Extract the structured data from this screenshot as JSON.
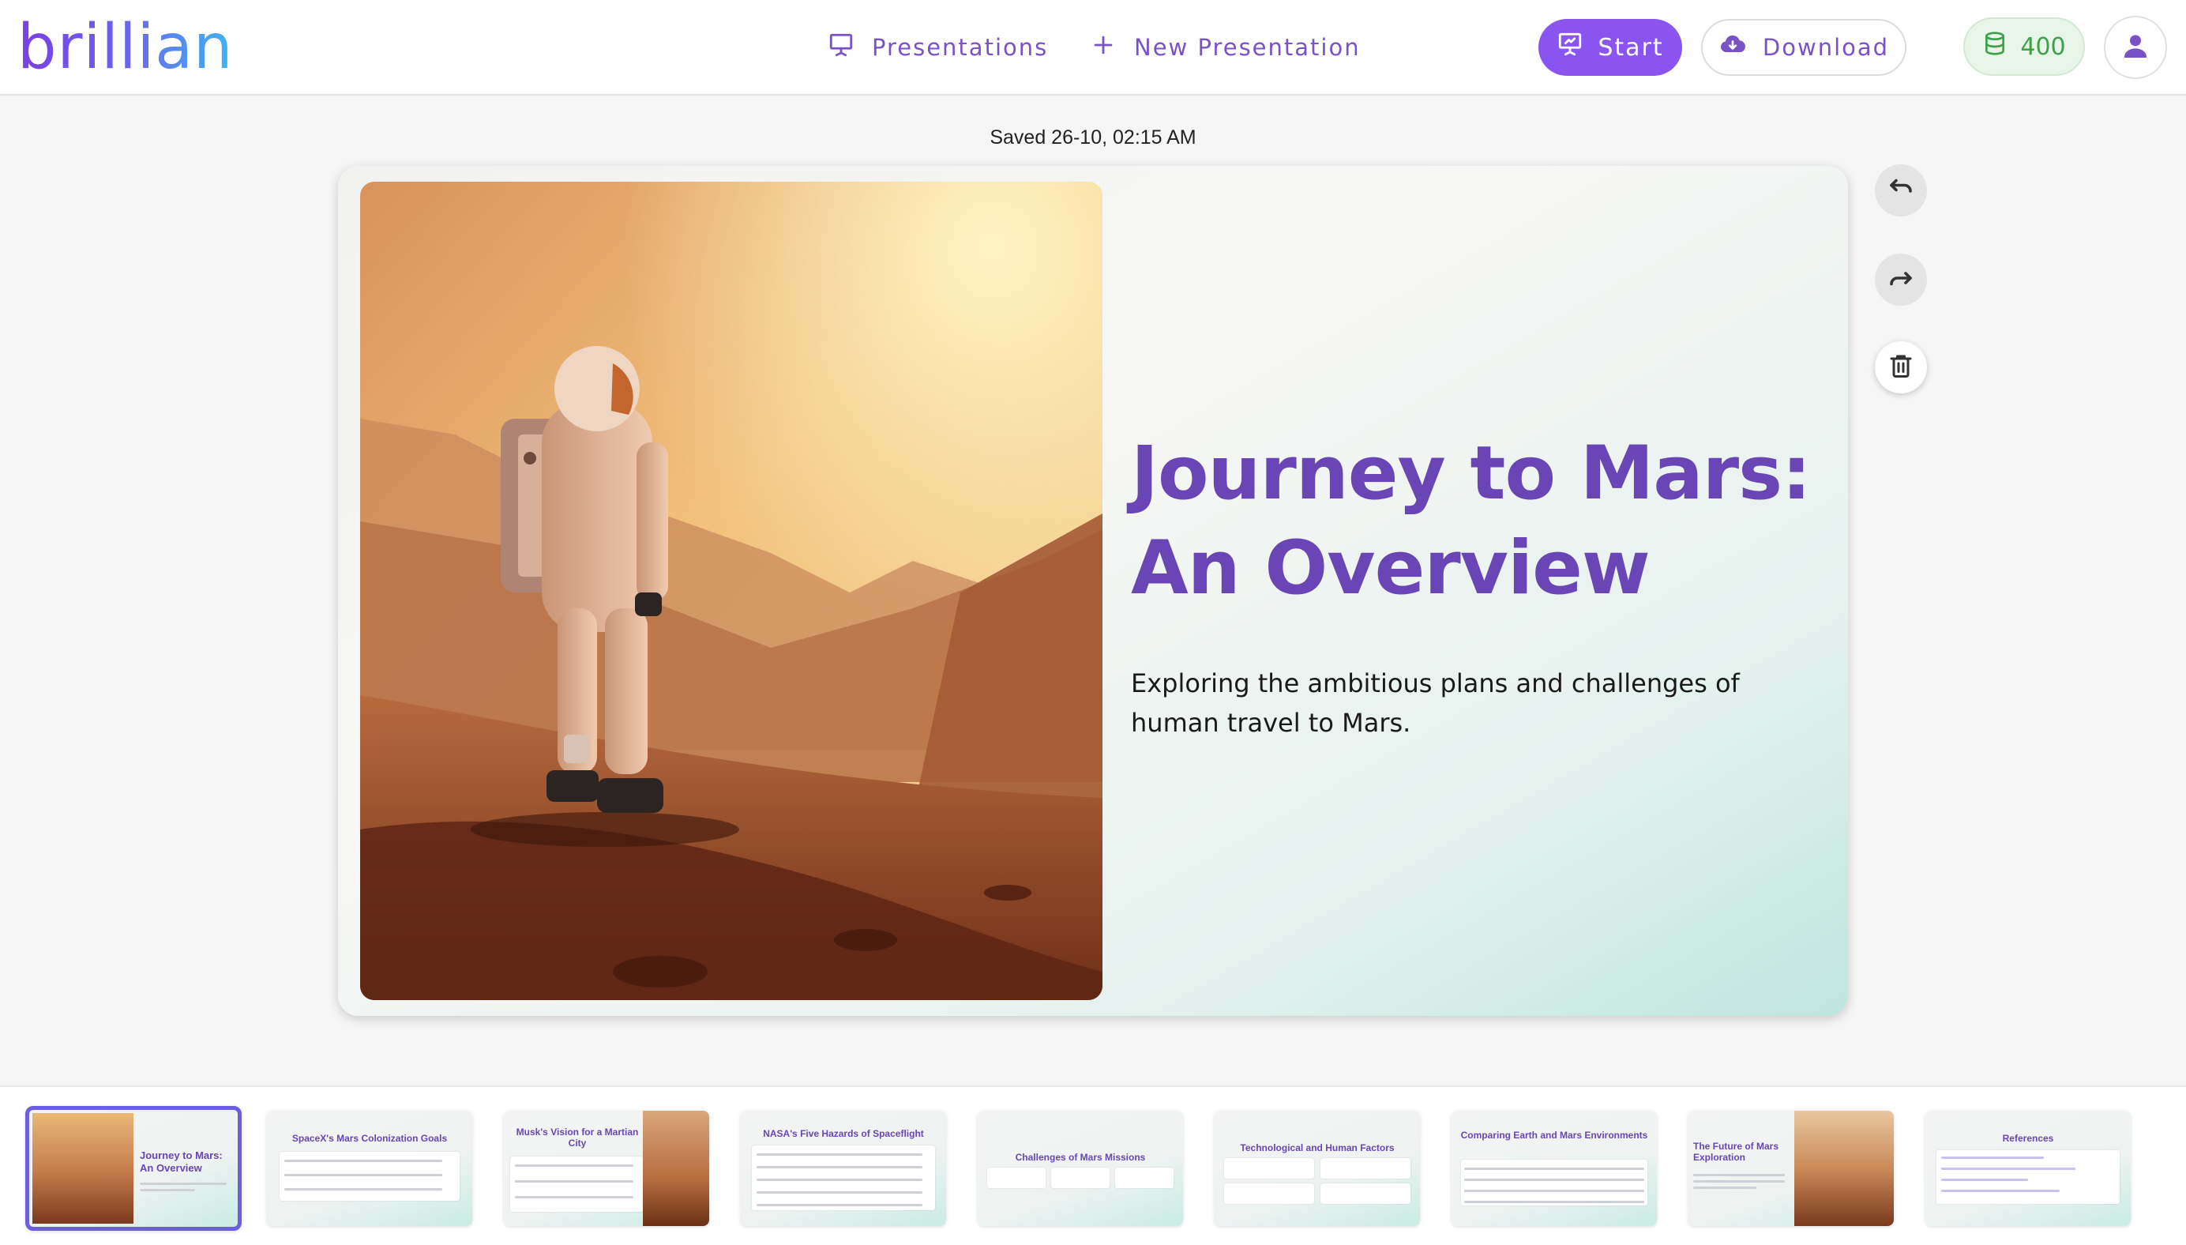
{
  "header": {
    "logo": "brillian",
    "nav": {
      "presentations_label": "Presentations",
      "new_presentation_label": "New Presentation"
    },
    "start_label": "Start",
    "download_label": "Download",
    "credits": "400"
  },
  "status": {
    "saved_text": "Saved 26-10, 02:15 AM"
  },
  "slide": {
    "title": "Journey to Mars: An Overview",
    "subtitle": "Exploring the ambitious plans and challenges of human travel to Mars."
  },
  "thumbnails": [
    {
      "title": "Journey to Mars: An Overview",
      "active": true
    },
    {
      "title": "SpaceX's Mars Colonization Goals"
    },
    {
      "title": "Musk's Vision for a Martian City"
    },
    {
      "title": "NASA's Five Hazards of Spaceflight"
    },
    {
      "title": "Challenges of Mars Missions"
    },
    {
      "title": "Technological and Human Factors"
    },
    {
      "title": "Comparing Earth and Mars Environments"
    },
    {
      "title": "The Future of Mars Exploration"
    },
    {
      "title": "References"
    }
  ],
  "colors": {
    "brand": "#8a54f0",
    "title": "#6a45b5",
    "credits": "#3fa04a",
    "active_thumb_border": "#6b5fe0"
  },
  "icons": {
    "presentations": "presentation-board-icon",
    "new": "plus-icon",
    "start": "presentation-board-icon",
    "download": "cloud-download-icon",
    "credits": "database-icon",
    "user": "user-icon",
    "undo": "undo-icon",
    "redo": "redo-icon",
    "delete": "trash-icon"
  }
}
